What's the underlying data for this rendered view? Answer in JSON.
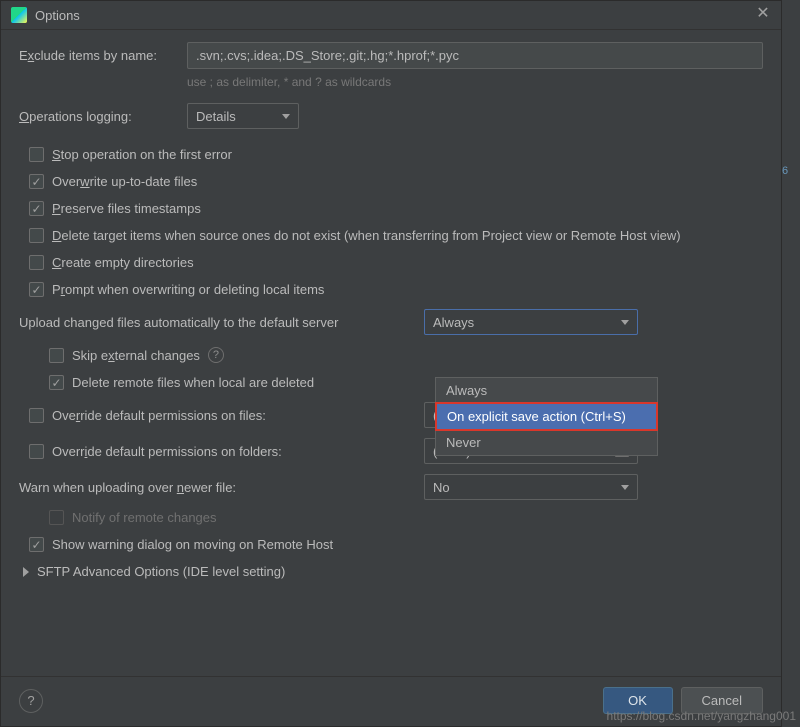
{
  "title": "Options",
  "exclude": {
    "label_pre": "E",
    "label_under": "x",
    "label_post": "clude items by name:",
    "value": ".svn;.cvs;.idea;.DS_Store;.git;.hg;*.hprof;*.pyc",
    "hint": "use ; as delimiter, * and ? as wildcards"
  },
  "operations_logging": {
    "label_under": "O",
    "label_post": "perations logging:",
    "value": "Details"
  },
  "checkboxes": {
    "stop_first_error": {
      "pre": "",
      "u": "S",
      "post": "top operation on the first error",
      "checked": false
    },
    "overwrite": {
      "pre": "Over",
      "u": "w",
      "post": "rite up-to-date files",
      "checked": true
    },
    "preserve": {
      "pre": "",
      "u": "P",
      "post": "reserve files timestamps",
      "checked": true
    },
    "delete_target": {
      "pre": "",
      "u": "D",
      "post": "elete target items when source ones do not exist (when transferring from Project view or Remote Host view)",
      "checked": false
    },
    "create_empty": {
      "pre": "",
      "u": "C",
      "post": "reate empty directories",
      "checked": false
    },
    "prompt_overwrite": {
      "pre": "P",
      "u": "r",
      "post": "ompt when overwriting or deleting local items",
      "checked": true
    }
  },
  "upload_changed": {
    "label": "Upload changed files automatically to the default server",
    "value": "Always"
  },
  "dropdown_options": [
    "Always",
    "On explicit save action (Ctrl+S)",
    "Never"
  ],
  "skip_external": {
    "pre": "Skip e",
    "u": "x",
    "post": "ternal changes",
    "checked": false
  },
  "delete_remote": {
    "label": "Delete remote files when local are deleted",
    "checked": true
  },
  "override_files": {
    "pre": "Ove",
    "u": "r",
    "post": "ride default permissions on files:",
    "checked": false,
    "value": "(none)"
  },
  "override_folders": {
    "pre": "Overr",
    "u": "i",
    "post": "de default permissions on folders:",
    "checked": false,
    "value": "(none)"
  },
  "warn_newer": {
    "pre": "Warn when uploading over ",
    "u": "n",
    "post": "ewer file:",
    "value": "No"
  },
  "notify_remote": {
    "label": "Notify of remote changes",
    "checked": false
  },
  "show_warning": {
    "label": "Show warning dialog on moving on Remote Host",
    "checked": true
  },
  "sftp_advanced": "SFTP Advanced Options (IDE level setting)",
  "buttons": {
    "ok": "OK",
    "cancel": "Cancel"
  },
  "watermark": "https://blog.csdn.net/yangzhang001",
  "side_text": "6"
}
